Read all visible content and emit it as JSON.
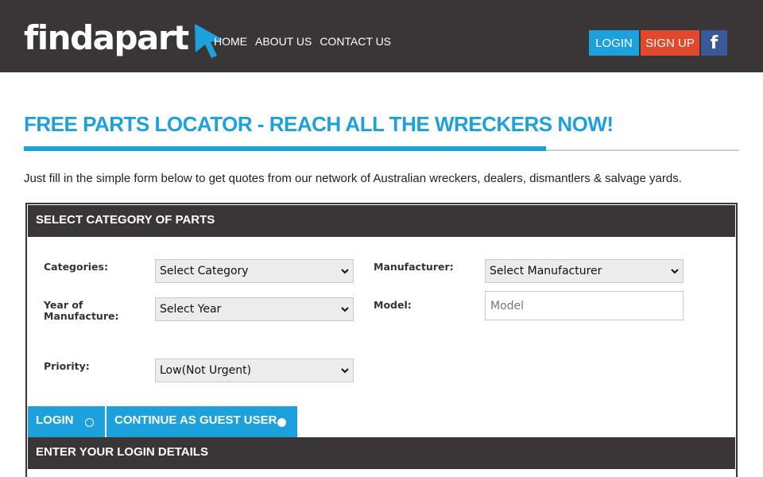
{
  "header": {
    "logo_text": "findapart",
    "nav": [
      "HOME",
      "ABOUT US",
      "CONTACT US"
    ],
    "login_label": "LOGIN",
    "signup_label": "SIGN UP",
    "facebook_label": "f"
  },
  "page": {
    "title": "FREE PARTS LOCATOR - REACH ALL THE WRECKERS NOW!",
    "intro": "Just fill in the simple form below to get quotes from our network of Australian wreckers, dealers, dismantlers & salvage yards."
  },
  "form": {
    "section_title": "SELECT CATEGORY OF PARTS",
    "categories_label": "Categories:",
    "categories_value": "Select Category",
    "manufacturer_label": "Manufacturer:",
    "manufacturer_value": "Select Manufacturer",
    "year_label_1": "Year of",
    "year_label_2": "Manufacture:",
    "year_value": "Select Year",
    "model_label": "Model:",
    "model_placeholder": "Model",
    "priority_label": "Priority:",
    "priority_value": "Low(Not Urgent)"
  },
  "tabs": {
    "login_label": "LOGIN",
    "guest_label": "CONTINUE AS GUEST USER"
  },
  "login_section": {
    "title": "ENTER YOUR LOGIN DETAILS"
  },
  "colors": {
    "accent": "#1da1dc",
    "header_bg": "#3a3536",
    "signup": "#e0492c",
    "facebook": "#3b5998"
  }
}
